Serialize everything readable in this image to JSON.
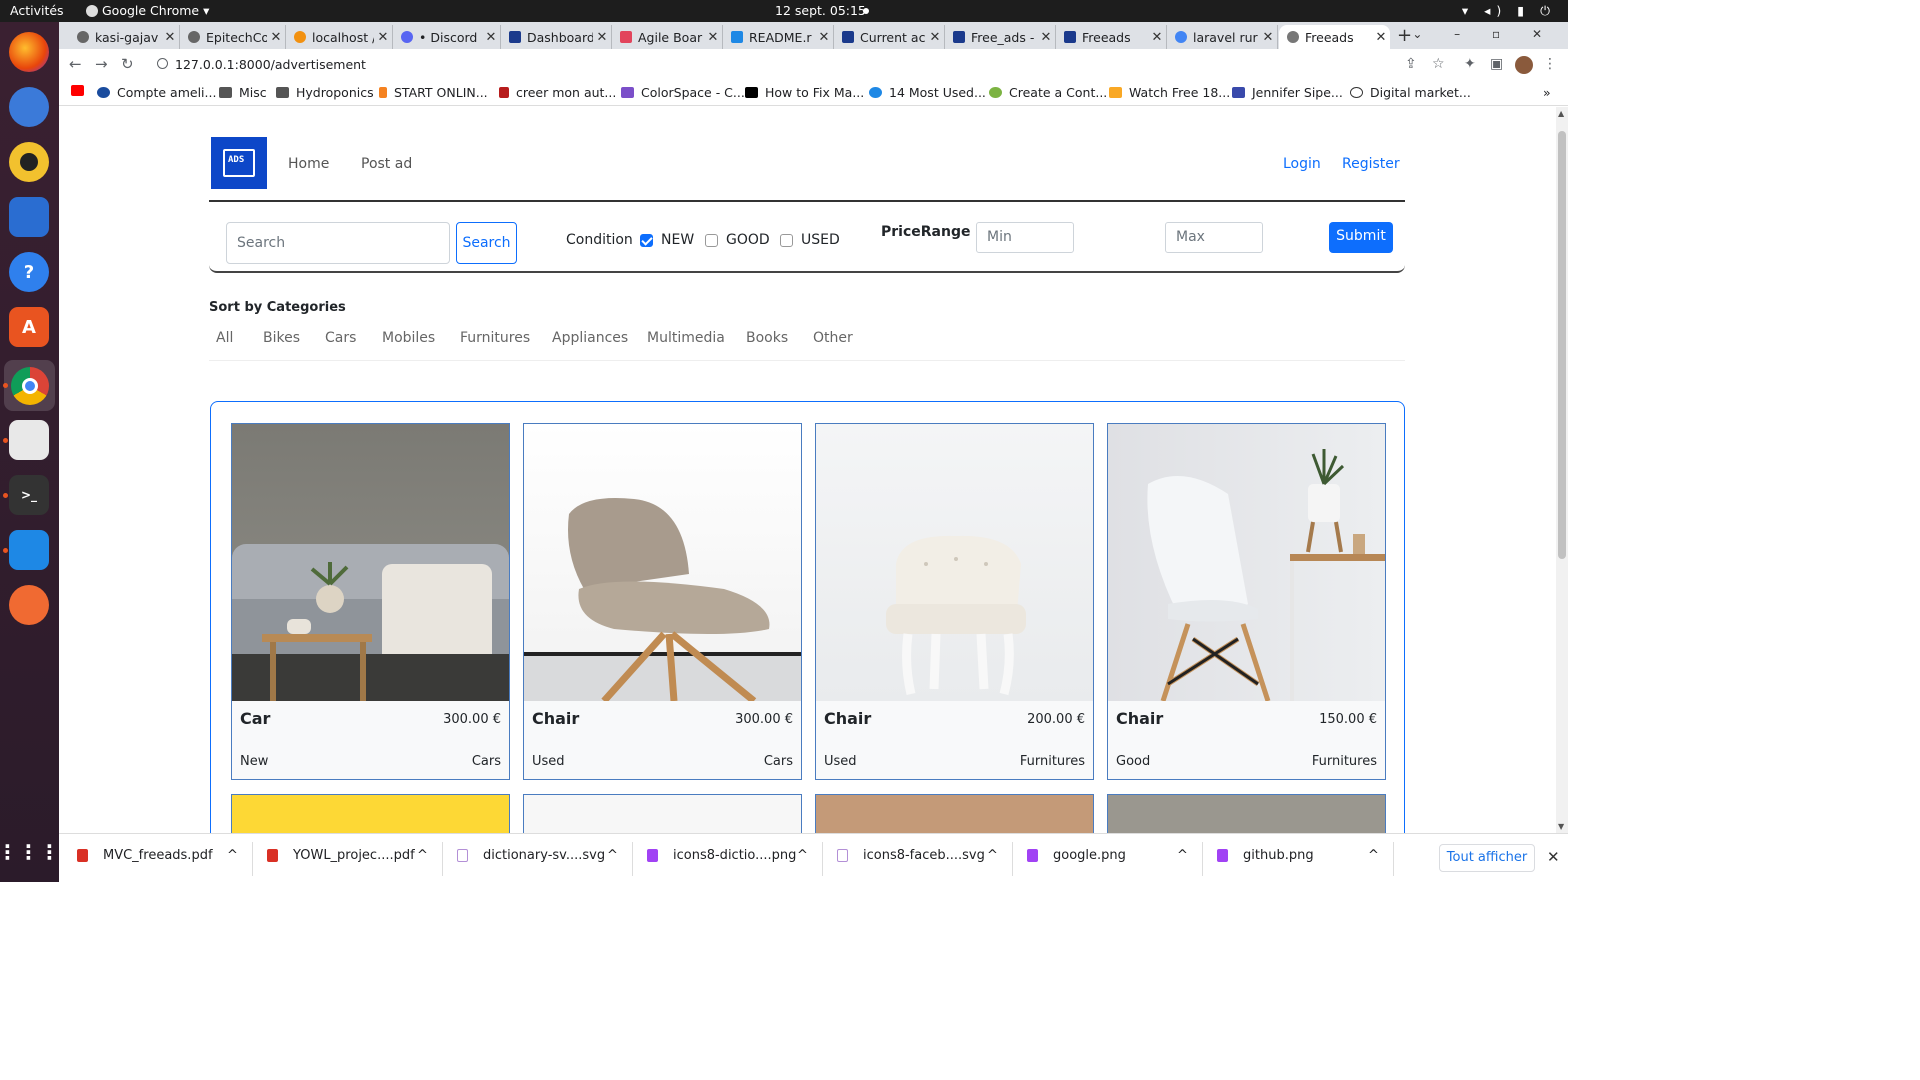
{
  "os": {
    "activities": "Activités",
    "app_name": "Google Chrome",
    "app_caret": "▾",
    "clock": "12 sept.  05:15",
    "sys_icons": "▾ ◂) ▮ ⏻"
  },
  "browser": {
    "tabs": [
      {
        "label": "kasi-gajav",
        "close": "✕"
      },
      {
        "label": "EpitechCo",
        "close": "✕"
      },
      {
        "label": "localhost /",
        "close": "✕"
      },
      {
        "label": "• Discord |",
        "close": "✕"
      },
      {
        "label": "Dashboard",
        "close": "✕"
      },
      {
        "label": "Agile Boar",
        "close": "✕"
      },
      {
        "label": "README.r",
        "close": "✕"
      },
      {
        "label": "Current ac",
        "close": "✕"
      },
      {
        "label": "Free_ads -",
        "close": "✕"
      },
      {
        "label": "Freeads",
        "close": "✕"
      },
      {
        "label": "laravel rur",
        "close": "✕"
      },
      {
        "label": "Freeads",
        "close": "✕"
      }
    ],
    "new_tab": "+",
    "window_controls": "⌄ – ▫ ✕",
    "url": "127.0.0.1:8000/advertisement",
    "nav_back": "←",
    "nav_forward": "→",
    "nav_reload": "↻",
    "bookmarks": [
      "Compte ameli...",
      "Misc",
      "Hydroponics",
      "START ONLIN...",
      "creer mon aut...",
      "ColorSpace - C...",
      "How to Fix Ma...",
      "14 Most Used...",
      "Create a Cont...",
      "Watch Free 18...",
      "Jennifer Sipe...",
      "Digital market..."
    ],
    "bookmarks_more": "»"
  },
  "site": {
    "logo_text": "ADS",
    "nav": {
      "home": "Home",
      "post_ad": "Post ad",
      "login": "Login",
      "register": "Register"
    },
    "filter": {
      "search_placeholder": "Search",
      "search_button": "Search",
      "condition_label": "Condition",
      "conditions": [
        {
          "label": "NEW",
          "checked": true
        },
        {
          "label": "GOOD",
          "checked": false
        },
        {
          "label": "USED",
          "checked": false
        }
      ],
      "price_range_label": "PriceRange",
      "min_placeholder": "Min",
      "max_placeholder": "Max",
      "submit": "Submit"
    },
    "categories": {
      "title": "Sort by Categories",
      "items": [
        "All",
        "Bikes",
        "Cars",
        "Mobiles",
        "Furnitures",
        "Appliances",
        "Multimedia",
        "Books",
        "Other"
      ]
    },
    "ads": [
      {
        "title": "Car",
        "price": "300.00 €",
        "condition": "New",
        "category": "Cars",
        "image": "sofa-with-side-table-photo"
      },
      {
        "title": "Chair",
        "price": "300.00 €",
        "condition": "Used",
        "category": "Cars",
        "image": "beige-lounge-chair-photo"
      },
      {
        "title": "Chair",
        "price": "200.00 €",
        "condition": "Used",
        "category": "Furnitures",
        "image": "white-tufted-chair-photo"
      },
      {
        "title": "Chair",
        "price": "150.00 €",
        "condition": "Good",
        "category": "Furnitures",
        "image": "white-shell-chair-photo"
      }
    ]
  },
  "downloads": {
    "items": [
      "MVC_freeads.pdf",
      "YOWL_projec....pdf",
      "dictionary-sv....svg",
      "icons8-dictio....png",
      "icons8-faceb....svg",
      "google.png",
      "github.png"
    ],
    "show_all": "Tout afficher",
    "close": "✕",
    "expand": "^"
  },
  "colors": {
    "accent": "#0d6efd",
    "logo_bg": "#0d47c8",
    "topbar": "#1d1d1d",
    "dock": "#2b1b2a"
  }
}
